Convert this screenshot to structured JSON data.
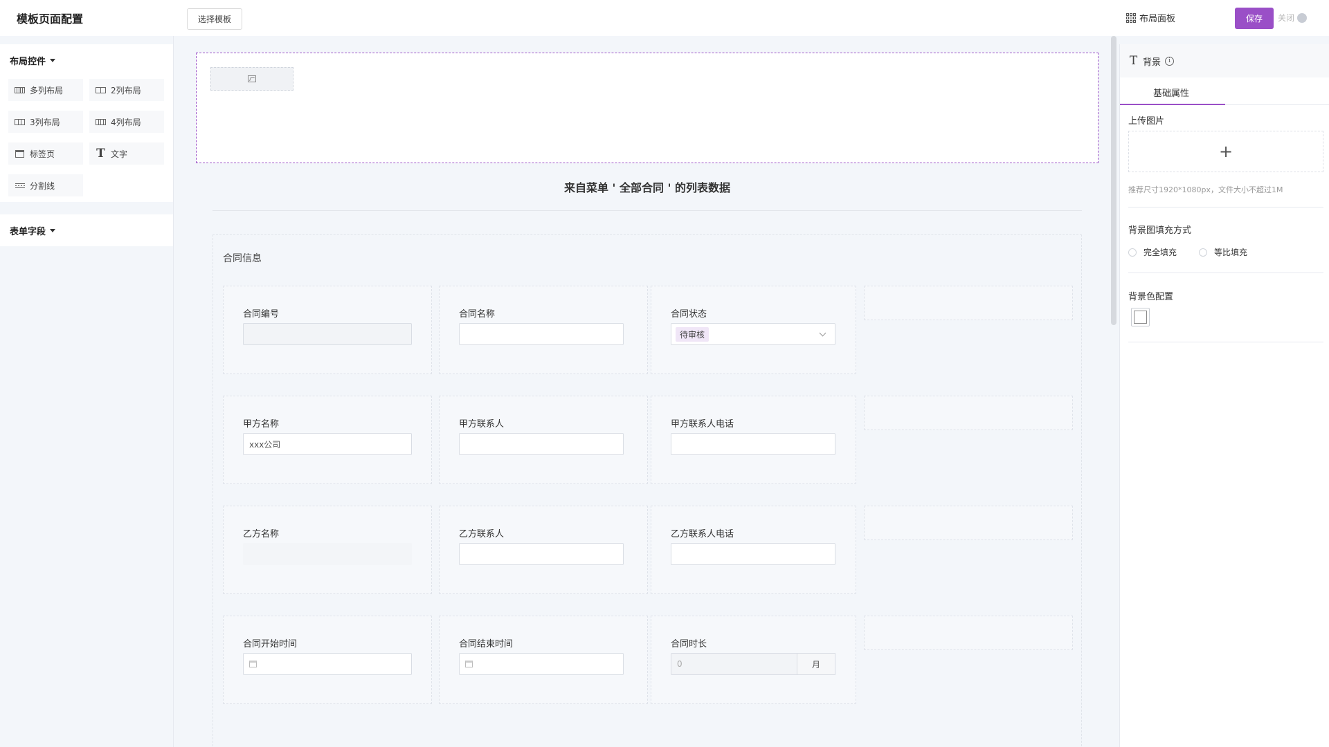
{
  "header": {
    "title": "模板页面配置",
    "select_template": "选择模板",
    "layout_panel": "布局面板",
    "save": "保存",
    "close": "关闭"
  },
  "left_panel": {
    "layout_section": "布局控件",
    "widgets": [
      {
        "label": "多列布局",
        "icon": "columns-icon"
      },
      {
        "label": "2列布局",
        "icon": "two-columns-icon"
      },
      {
        "label": "3列布局",
        "icon": "three-columns-icon"
      },
      {
        "label": "4列布局",
        "icon": "four-columns-icon"
      },
      {
        "label": "标签页",
        "icon": "tab-icon"
      },
      {
        "label": "文字",
        "icon": "text-icon"
      },
      {
        "label": "分割线",
        "icon": "divider-icon"
      }
    ],
    "form_section": "表单字段"
  },
  "canvas": {
    "list_title": "来自菜单 ' 全部合同 ' 的列表数据",
    "group_label": "合同信息",
    "rows": [
      [
        {
          "label": "合同编号",
          "value": "",
          "kind": "disabled"
        },
        {
          "label": "合同名称",
          "value": "",
          "kind": "text"
        },
        {
          "label": "合同状态",
          "value": "待审核",
          "kind": "select"
        }
      ],
      [
        {
          "label": "甲方名称",
          "value": "xxx公司",
          "kind": "text"
        },
        {
          "label": "甲方联系人",
          "value": "",
          "kind": "text"
        },
        {
          "label": "甲方联系人电话",
          "value": "",
          "kind": "text"
        }
      ],
      [
        {
          "label": "乙方名称",
          "value": "",
          "kind": "ghost"
        },
        {
          "label": "乙方联系人",
          "value": "",
          "kind": "text"
        },
        {
          "label": "乙方联系人电话",
          "value": "",
          "kind": "text"
        }
      ],
      [
        {
          "label": "合同开始时间",
          "value": "",
          "kind": "date"
        },
        {
          "label": "合同结束时间",
          "value": "",
          "kind": "date"
        },
        {
          "label": "合同时长",
          "value": "0",
          "kind": "unit",
          "unit": "月"
        }
      ]
    ]
  },
  "right_panel": {
    "title": "背景",
    "tab": "基础属性",
    "upload_label": "上传图片",
    "upload_hint": "推荐尺寸1920*1080px，文件大小不超过1M",
    "fill_label": "背景图填充方式",
    "fill_options": [
      "完全填充",
      "等比填充"
    ],
    "color_label": "背景色配置",
    "color_value": "#ffffff"
  },
  "colors": {
    "accent": "#9a4fc7",
    "tag_bg": "#f0e6f7"
  }
}
